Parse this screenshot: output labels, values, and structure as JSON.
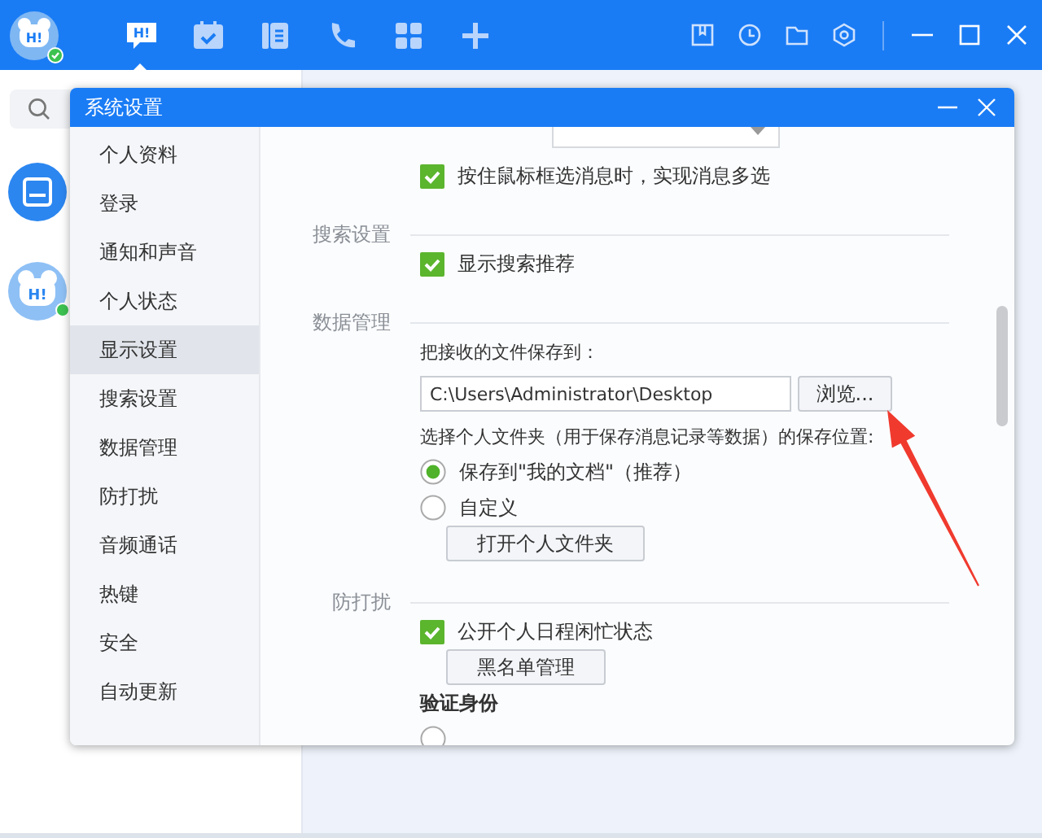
{
  "app": {
    "avatar": {
      "label": "H!",
      "online": true
    },
    "nav": [
      {
        "kind": "chat",
        "label": "H!",
        "selected": true
      },
      {
        "kind": "calendar",
        "selected": false
      },
      {
        "kind": "notes",
        "selected": false
      },
      {
        "kind": "phone",
        "selected": false
      },
      {
        "kind": "apps",
        "selected": false
      },
      {
        "kind": "add",
        "selected": false
      }
    ]
  },
  "contacts": [
    {
      "kind": "inbox"
    },
    {
      "kind": "avatar",
      "label": "H!",
      "online": true
    }
  ],
  "dialog": {
    "title": "系统设置",
    "sidebar": {
      "items": [
        {
          "label": "个人资料",
          "selected": false
        },
        {
          "label": "登录",
          "selected": false
        },
        {
          "label": "通知和声音",
          "selected": false
        },
        {
          "label": "个人状态",
          "selected": false
        },
        {
          "label": "显示设置",
          "selected": true
        },
        {
          "label": "搜索设置",
          "selected": false
        },
        {
          "label": "数据管理",
          "selected": false
        },
        {
          "label": "防打扰",
          "selected": false
        },
        {
          "label": "音频通话",
          "selected": false
        },
        {
          "label": "热键",
          "selected": false
        },
        {
          "label": "安全",
          "selected": false
        },
        {
          "label": "自动更新",
          "selected": false
        }
      ]
    },
    "groups": [
      {
        "rows": [
          {
            "kind": "select"
          },
          {
            "kind": "checkbox",
            "label": "按住鼠标框选消息时，实现消息多选",
            "checked": true
          }
        ]
      },
      {
        "title": "搜索设置",
        "rows": [
          {
            "kind": "checkbox",
            "label": "显示搜索推荐",
            "checked": true
          }
        ]
      },
      {
        "title": "数据管理",
        "rows": [
          {
            "kind": "text",
            "label": "把接收的文件保存到："
          },
          {
            "kind": "path",
            "value": "C:\\Users\\Administrator\\Desktop",
            "button": "浏览..."
          },
          {
            "kind": "text",
            "label": "选择个人文件夹（用于保存消息记录等数据）的保存位置:"
          },
          {
            "kind": "radio",
            "label": "保存到\"我的文档\"（推荐）",
            "selected": true
          },
          {
            "kind": "radio",
            "label": "自定义",
            "selected": false
          },
          {
            "kind": "button",
            "label": "打开个人文件夹"
          }
        ]
      },
      {
        "title": "防打扰",
        "rows": [
          {
            "kind": "checkbox",
            "label": "公开个人日程闲忙状态",
            "checked": true
          },
          {
            "kind": "button",
            "label": "黑名单管理"
          },
          {
            "kind": "heading",
            "label": "验证身份"
          },
          {
            "kind": "radio",
            "selected": false
          }
        ]
      }
    ]
  }
}
